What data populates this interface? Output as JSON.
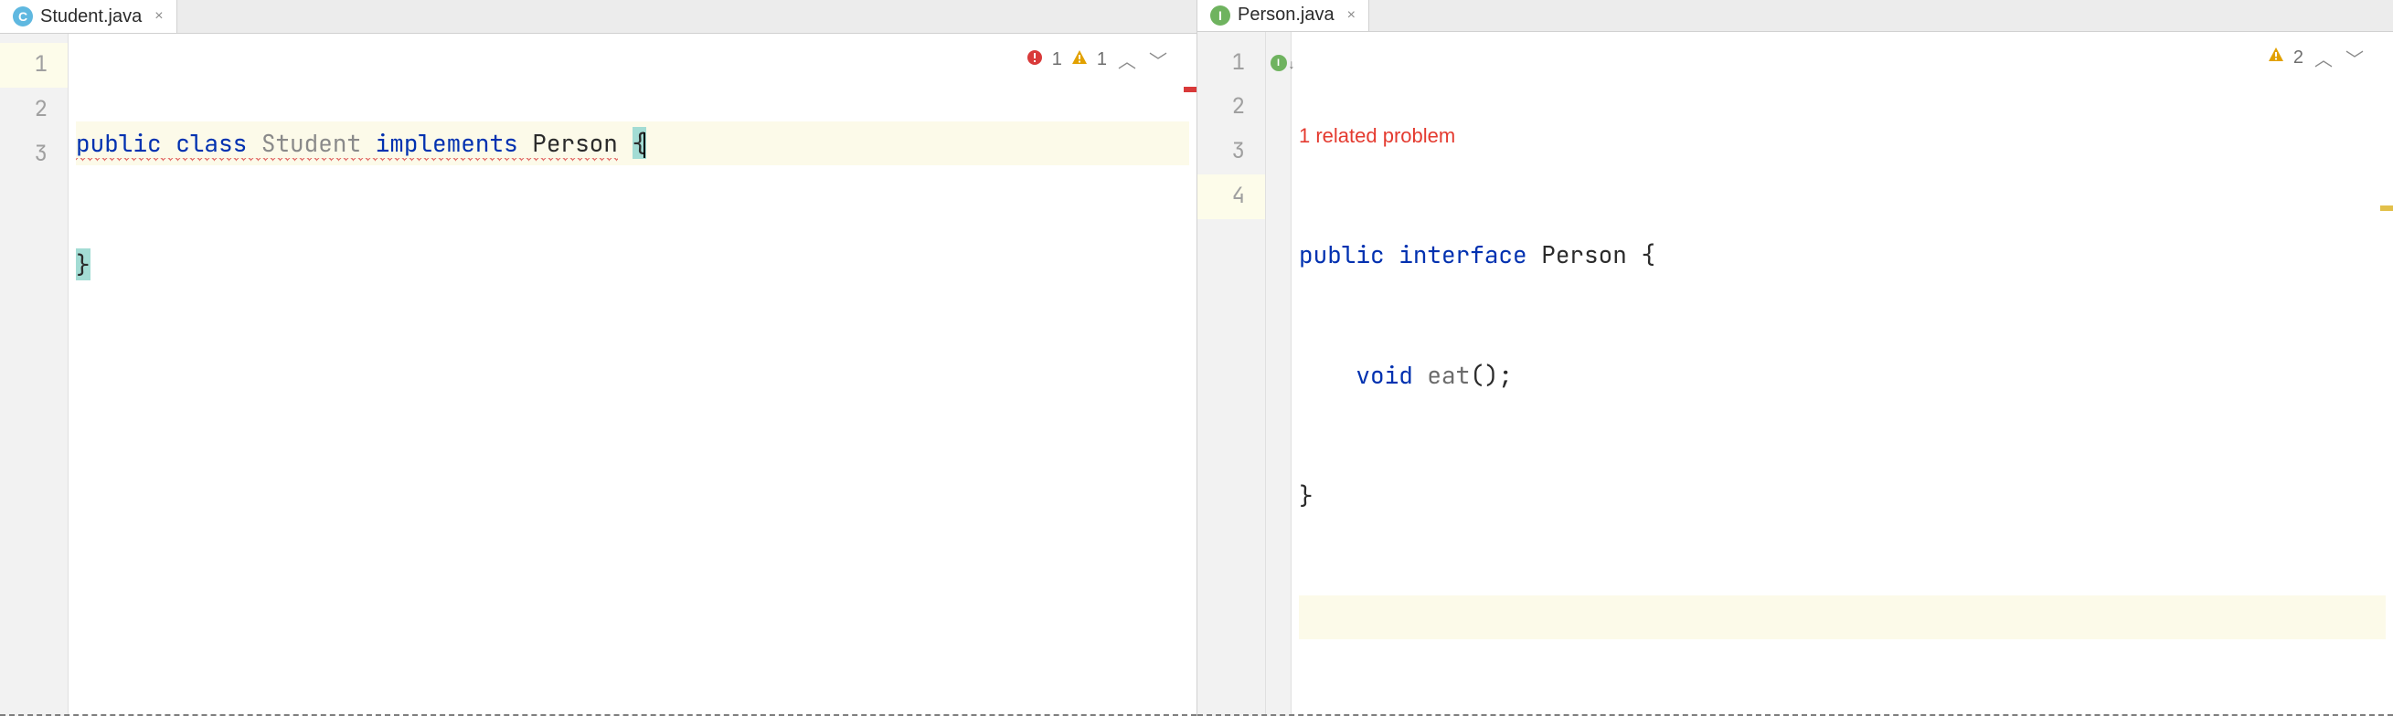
{
  "left": {
    "tab": {
      "icon_letter": "C",
      "filename": "Student.java"
    },
    "gutter": [
      "1",
      "2",
      "3"
    ],
    "code": {
      "l1_kw_public": "public",
      "l1_kw_class": "class",
      "l1_name": "Student",
      "l1_kw_impl": "implements",
      "l1_iface": "Person",
      "l1_brace": "{",
      "l2_brace": "}"
    },
    "inspection": {
      "errors": "1",
      "warnings": "1"
    }
  },
  "right": {
    "tab": {
      "icon_letter": "I",
      "filename": "Person.java"
    },
    "related": "1 related problem",
    "gutter": [
      "1",
      "2",
      "3",
      "4"
    ],
    "code": {
      "l1_kw_public": "public",
      "l1_kw_interface": "interface",
      "l1_name": "Person",
      "l1_brace": "{",
      "l2_indent": "    ",
      "l2_kw_void": "void",
      "l2_method": "eat",
      "l2_parens": "();",
      "l3_brace": "}"
    },
    "inspection": {
      "warnings": "2"
    }
  }
}
